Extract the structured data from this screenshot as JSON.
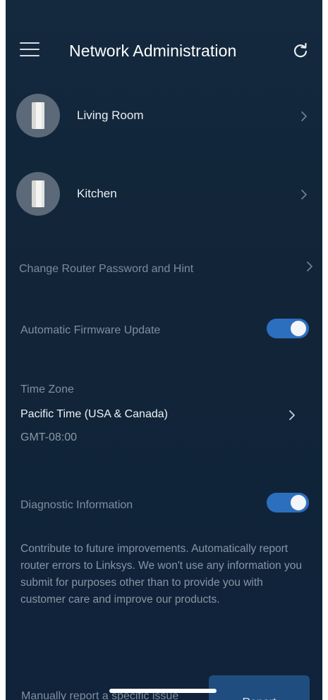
{
  "header": {
    "title": "Network Administration",
    "menu_icon": "hamburger-menu-icon",
    "refresh_icon": "refresh-icon"
  },
  "devices": [
    {
      "label": "Living Room",
      "icon": "mesh-node-icon"
    },
    {
      "label": "Kitchen",
      "icon": "mesh-node-icon"
    }
  ],
  "settings": {
    "change_password_label": "Change Router Password and Hint",
    "firmware_update_label": "Automatic Firmware Update",
    "firmware_update_on": true,
    "time_zone_heading": "Time Zone",
    "time_zone_value": "Pacific Time (USA & Canada)",
    "time_zone_offset": "GMT-08:00",
    "diagnostic_label": "Diagnostic Information",
    "diagnostic_on": true,
    "diagnostic_description": "Contribute to future improvements. Automatically report router errors to Linksys. We won't use any information you submit for purposes other than to provide you with customer care and improve our products.",
    "manual_report_label": "Manually report a specific issue",
    "report_button_label": "Report"
  },
  "colors": {
    "background": "#12263a",
    "toggle_on": "#2d6fbf",
    "button": "#1f4d7f"
  }
}
